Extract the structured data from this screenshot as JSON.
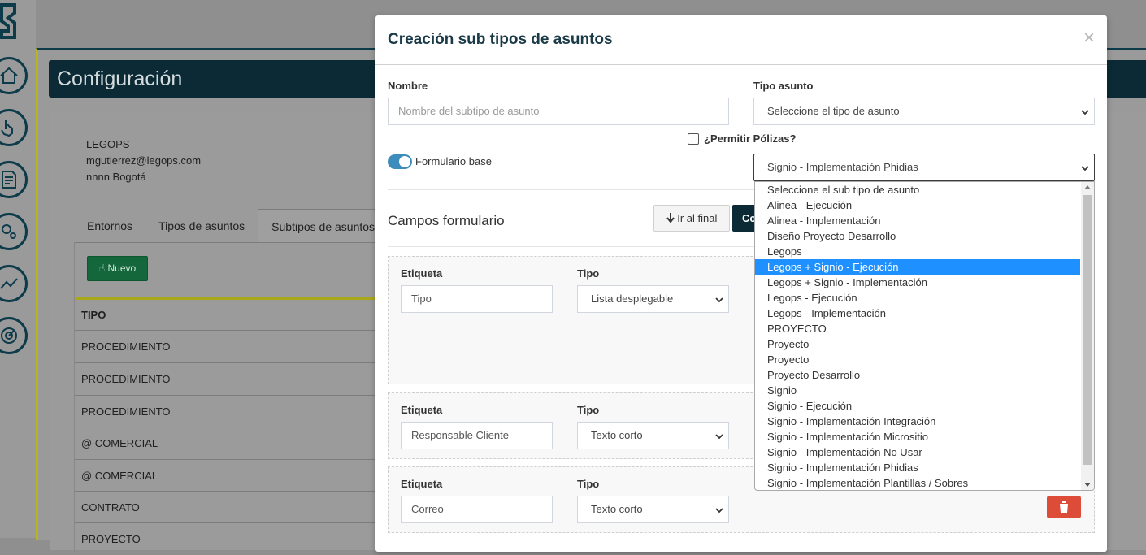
{
  "page": {
    "title": "Configuración",
    "company": "LEGOPS",
    "email": "mgutierrez@legops.com",
    "location": "nnnn Bogotá",
    "tabs": [
      "Entornos",
      "Tipos de asuntos",
      "Subtipos de asuntos"
    ],
    "new_button": "Nuevo",
    "table_header": "TIPO",
    "rows": [
      "PROCEDIMIENTO",
      "PROCEDIMIENTO",
      "PROCEDIMIENTO",
      "@ COMERCIAL",
      "@ COMERCIAL",
      "CONTRATO",
      "PROYECTO"
    ]
  },
  "modal": {
    "title": "Creación sub tipos de asuntos",
    "close": "×",
    "name_label": "Nombre",
    "name_placeholder": "Nombre del subtipo de asunto",
    "type_label": "Tipo asunto",
    "type_value": "Seleccione el tipo de asunto",
    "polizas_label": "¿Permitir Pólizas?",
    "form_base_label": "Formulario base",
    "subtype_value": "Signio - Implementación Phidias",
    "section_title": "Campos formulario",
    "go_end_button": "Ir al final",
    "co_button": "Co",
    "fields": [
      {
        "label_title": "Etiqueta",
        "label_value": "Tipo",
        "type_title": "Tipo",
        "type_value": "Lista desplegable"
      },
      {
        "label_title": "Etiqueta",
        "label_value": "Responsable Cliente",
        "type_title": "Tipo",
        "type_value": "Texto corto"
      },
      {
        "label_title": "Etiqueta",
        "label_value": "Correo",
        "type_title": "Tipo",
        "type_value": "Texto corto"
      }
    ]
  },
  "dropdown": {
    "selected_index": 5,
    "options": [
      "Seleccione el sub tipo de asunto",
      "Alinea - Ejecución",
      "Alinea - Implementación",
      "Diseño Proyecto Desarrollo",
      "Legops",
      "Legops + Signio - Ejecución",
      "Legops + Signio - Implementación",
      "Legops - Ejecución",
      "Legops - Implementación",
      "PROYECTO",
      "Proyecto",
      "Proyecto",
      "Proyecto Desarrollo",
      "Signio",
      "Signio - Ejecución",
      "Signio - Implementación Integración",
      "Signio - Implementación Micrositio",
      "Signio - Implementación No Usar",
      "Signio - Implementación Phidias",
      "Signio - Implementación Plantillas / Sobres"
    ]
  },
  "colors": {
    "primary_dark": "#0b2a35",
    "accent_yellow": "#b7b51a",
    "select_highlight": "#1e90ff",
    "toggle_on": "#3c8dbc",
    "danger": "#dd4b39",
    "success": "#14673a"
  },
  "icons": [
    "logo-icon",
    "home-icon",
    "hand-pointer-icon",
    "document-icon",
    "gears-icon",
    "chart-line-icon",
    "radar-icon",
    "arrow-down-icon",
    "plus-hand-icon",
    "trash-icon",
    "chevron-down-icon"
  ]
}
